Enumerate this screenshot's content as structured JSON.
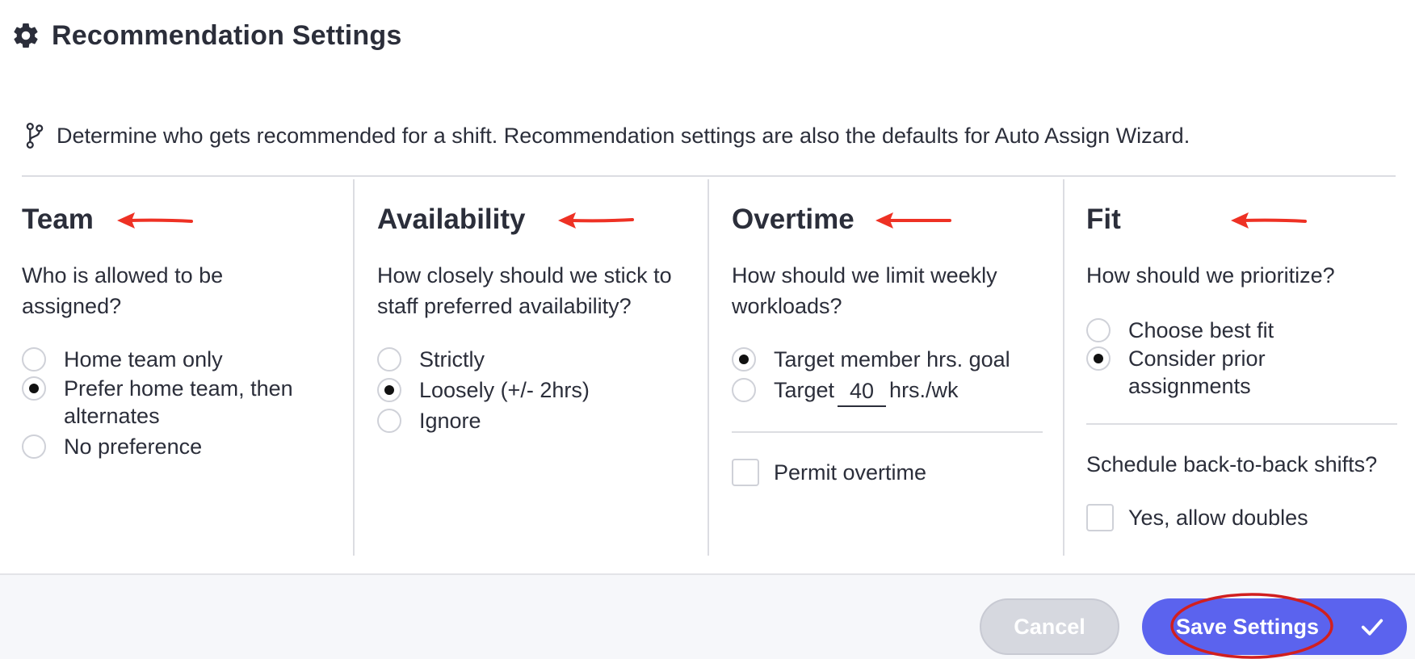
{
  "header": {
    "title": "Recommendation Settings",
    "icon": "gear-icon"
  },
  "description": {
    "text": "Determine who gets recommended for a shift. Recommendation settings are also the defaults for Auto Assign Wizard.",
    "icon": "branch-icon"
  },
  "annotations": {
    "arrow_color": "#ee3124",
    "ellipse_color": "#d11f1f"
  },
  "team": {
    "title": "Team",
    "question": "Who is allowed to be assigned?",
    "options": [
      {
        "label": "Home team only",
        "selected": false
      },
      {
        "label": "Prefer home team, then alternates",
        "selected": true
      },
      {
        "label": "No preference",
        "selected": false
      }
    ]
  },
  "availability": {
    "title": "Availability",
    "question": "How closely should we stick to staff preferred availability?",
    "options": [
      {
        "label": "Strictly",
        "selected": false
      },
      {
        "label": "Loosely (+/- 2hrs)",
        "selected": true
      },
      {
        "label": "Ignore",
        "selected": false
      }
    ]
  },
  "overtime": {
    "title": "Overtime",
    "question": "How should we limit weekly workloads?",
    "options": [
      {
        "label": "Target member hrs. goal",
        "selected": true
      },
      {
        "label_prefix": "Target",
        "value": "40",
        "label_suffix": "hrs./wk",
        "selected": false
      }
    ],
    "permit_label": "Permit overtime",
    "permit_checked": false
  },
  "fit": {
    "title": "Fit",
    "question": "How should we prioritize?",
    "options": [
      {
        "label": "Choose best fit",
        "selected": false
      },
      {
        "label": "Consider prior assignments",
        "selected": true
      }
    ],
    "doubles_question": "Schedule back-to-back shifts?",
    "doubles_label": "Yes, allow doubles",
    "doubles_checked": false
  },
  "footer": {
    "cancel_label": "Cancel",
    "save_label": "Save Settings",
    "accent_color": "#5b63ee"
  }
}
